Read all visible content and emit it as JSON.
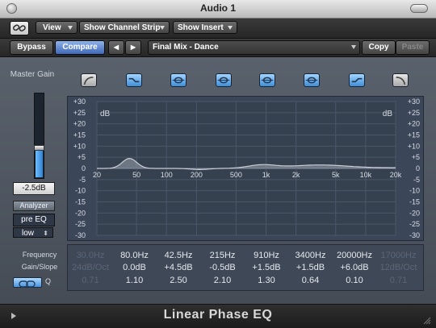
{
  "window": {
    "title": "Audio 1"
  },
  "toolbar": {
    "view_label": "View",
    "channel_strip_label": "Show Channel Strip",
    "insert_label": "Show Insert"
  },
  "controls": {
    "bypass_label": "Bypass",
    "compare_label": "Compare",
    "prev_label": "◀",
    "next_label": "▶",
    "preset_value": "Final Mix - Dance",
    "copy_label": "Copy",
    "paste_label": "Paste"
  },
  "left_panel": {
    "master_gain_label": "Master Gain",
    "master_gain_value": "-2.5dB",
    "master_gain_level": 0.35,
    "analyzer_label": "Analyzer",
    "analyzer_mode": "pre EQ",
    "resolution_value": "low"
  },
  "bands": [
    {
      "icon": "low-cut-icon",
      "active": false
    },
    {
      "icon": "low-shelf-icon",
      "active": true
    },
    {
      "icon": "parametric-band-icon",
      "active": true
    },
    {
      "icon": "parametric-band-icon",
      "active": true
    },
    {
      "icon": "parametric-band-icon",
      "active": true
    },
    {
      "icon": "parametric-band-icon",
      "active": true
    },
    {
      "icon": "high-shelf-icon",
      "active": true
    },
    {
      "icon": "high-cut-icon",
      "active": false
    }
  ],
  "graph": {
    "unit_left": "dB",
    "unit_right": "dB",
    "y_ticks": [
      "+30",
      "+25",
      "+20",
      "+15",
      "+10",
      "+5",
      "0",
      "-5",
      "-10",
      "-15",
      "-20",
      "-25",
      "-30"
    ],
    "x_ticks": [
      "20",
      "50",
      "100",
      "200",
      "500",
      "1k",
      "2k",
      "5k",
      "10k",
      "20k"
    ]
  },
  "parameters": {
    "frequency_label": "Frequency",
    "gain_slope_label": "Gain/Slope",
    "q_label": "Q",
    "frequency": [
      "30.0Hz",
      "80.0Hz",
      "42.5Hz",
      "215Hz",
      "910Hz",
      "3400Hz",
      "20000Hz",
      "17000Hz"
    ],
    "gain": [
      "24dB/Oct",
      "0.0dB",
      "+4.5dB",
      "-0.5dB",
      "+1.5dB",
      "+1.5dB",
      "+6.0dB",
      "12dB/Oct"
    ],
    "q": [
      "0.71",
      "1.10",
      "2.50",
      "2.10",
      "1.30",
      "0.64",
      "0.10",
      "0.71"
    ]
  },
  "footer": {
    "plugin_name": "Linear Phase EQ"
  },
  "colors": {
    "accent": "#3f8ed7",
    "graph_bg": "#3b4658",
    "panel_bg": "#505863"
  }
}
